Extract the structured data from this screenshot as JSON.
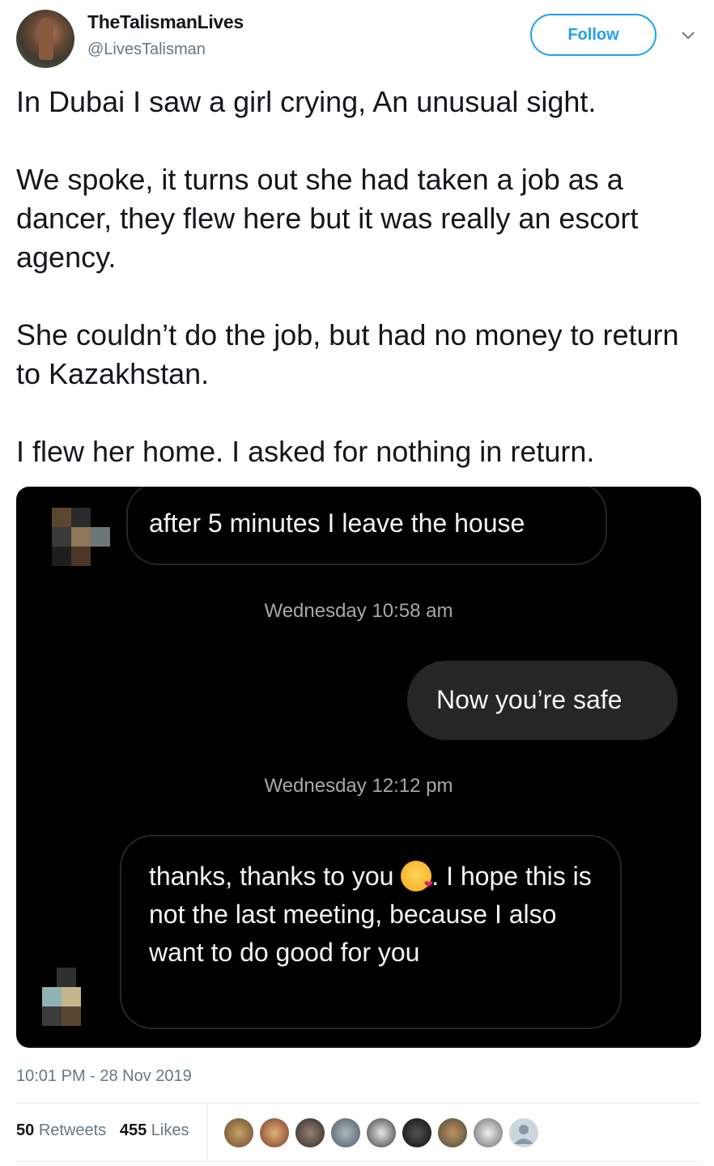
{
  "header": {
    "display_name": "TheTalismanLives",
    "handle": "@LivesTalisman",
    "follow_label": "Follow"
  },
  "tweet": {
    "text": "In Dubai I saw a girl crying, An unusual sight.\n\nWe spoke, it turns out she had taken a job as a dancer, they flew here but it was really an escort agency.\n\nShe couldn’t do the job, but had no money to return to Kazakhstan.\n\nI flew her home. I asked for nothing in return."
  },
  "media": {
    "messages": [
      {
        "text": "after 5 minutes I leave the house"
      },
      {
        "timestamp": "Wednesday 10:58 am"
      },
      {
        "text": "Now you’re safe"
      },
      {
        "timestamp": "Wednesday 12:12 pm"
      },
      {
        "text_before_emoji": "thanks, thanks to you ",
        "emoji": "kissing-face-emoji",
        "text_after_emoji": ".  I hope this is not the last meeting, because I also want to do good for you"
      }
    ]
  },
  "footer": {
    "timestamp": "10:01 PM - 28 Nov 2019",
    "retweet_count": "50",
    "retweet_label": "Retweets",
    "like_count": "455",
    "like_label": "Likes"
  },
  "colors": {
    "accent": "#1da1f2",
    "text": "#14171a",
    "muted": "#657786",
    "dm_background": "#000000",
    "dm_bubble_out": "#262626"
  }
}
